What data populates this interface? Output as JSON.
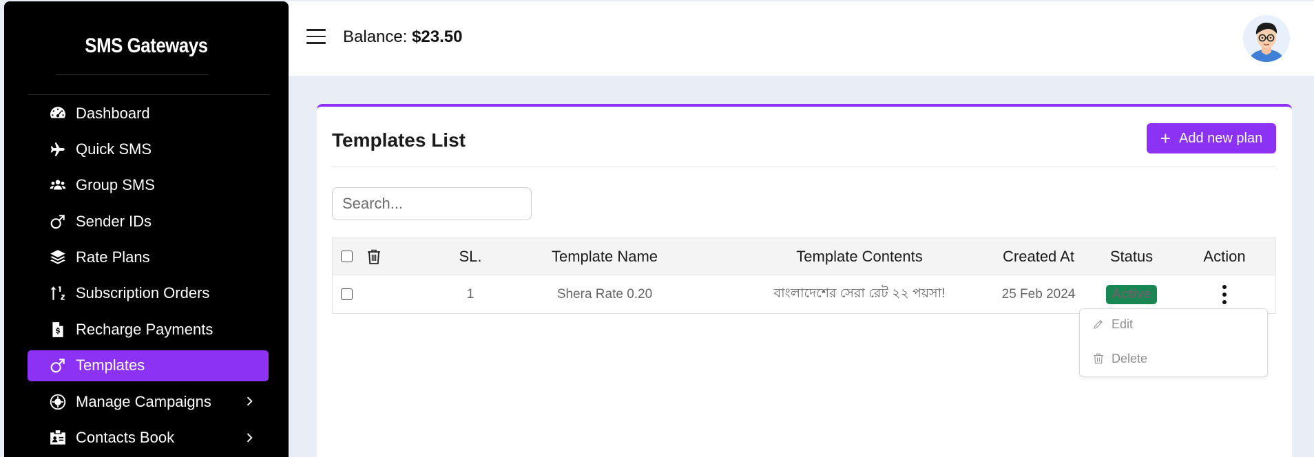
{
  "sidebar": {
    "brand": "SMS Gateways",
    "items": [
      {
        "label": "Dashboard",
        "icon": "dashboard-icon"
      },
      {
        "label": "Quick SMS",
        "icon": "plane-icon"
      },
      {
        "label": "Group SMS",
        "icon": "users-icon"
      },
      {
        "label": "Sender IDs",
        "icon": "mars-icon"
      },
      {
        "label": "Rate Plans",
        "icon": "layers-icon"
      },
      {
        "label": "Subscription Orders",
        "icon": "sort-icon"
      },
      {
        "label": "Recharge Payments",
        "icon": "invoice-dollar-icon"
      },
      {
        "label": "Templates",
        "icon": "mars-icon",
        "active": true
      },
      {
        "label": "Manage Campaigns",
        "icon": "campaign-icon",
        "has_submenu": true
      },
      {
        "label": "Contacts Book",
        "icon": "id-badge-icon",
        "has_submenu": true
      }
    ]
  },
  "topbar": {
    "balance_label": "Balance:",
    "balance_value": "$23.50"
  },
  "card": {
    "title": "Templates List",
    "add_button_label": "Add new plan",
    "search_placeholder": "Search..."
  },
  "table": {
    "columns": [
      "SL.",
      "Template Name",
      "Template Contents",
      "Created At",
      "Status",
      "Action"
    ],
    "rows": [
      {
        "sl": "1",
        "name": "Shera Rate 0.20",
        "contents": "বাংলাদেশের সেরা রেট ২২ পয়সা!",
        "created_at": "25 Feb 2024",
        "status": "Active"
      }
    ]
  },
  "action_menu": {
    "edit_label": "Edit",
    "delete_label": "Delete"
  },
  "colors": {
    "accent": "#8b32f5",
    "sidebar_bg": "#000000",
    "status_active": "#198754"
  }
}
